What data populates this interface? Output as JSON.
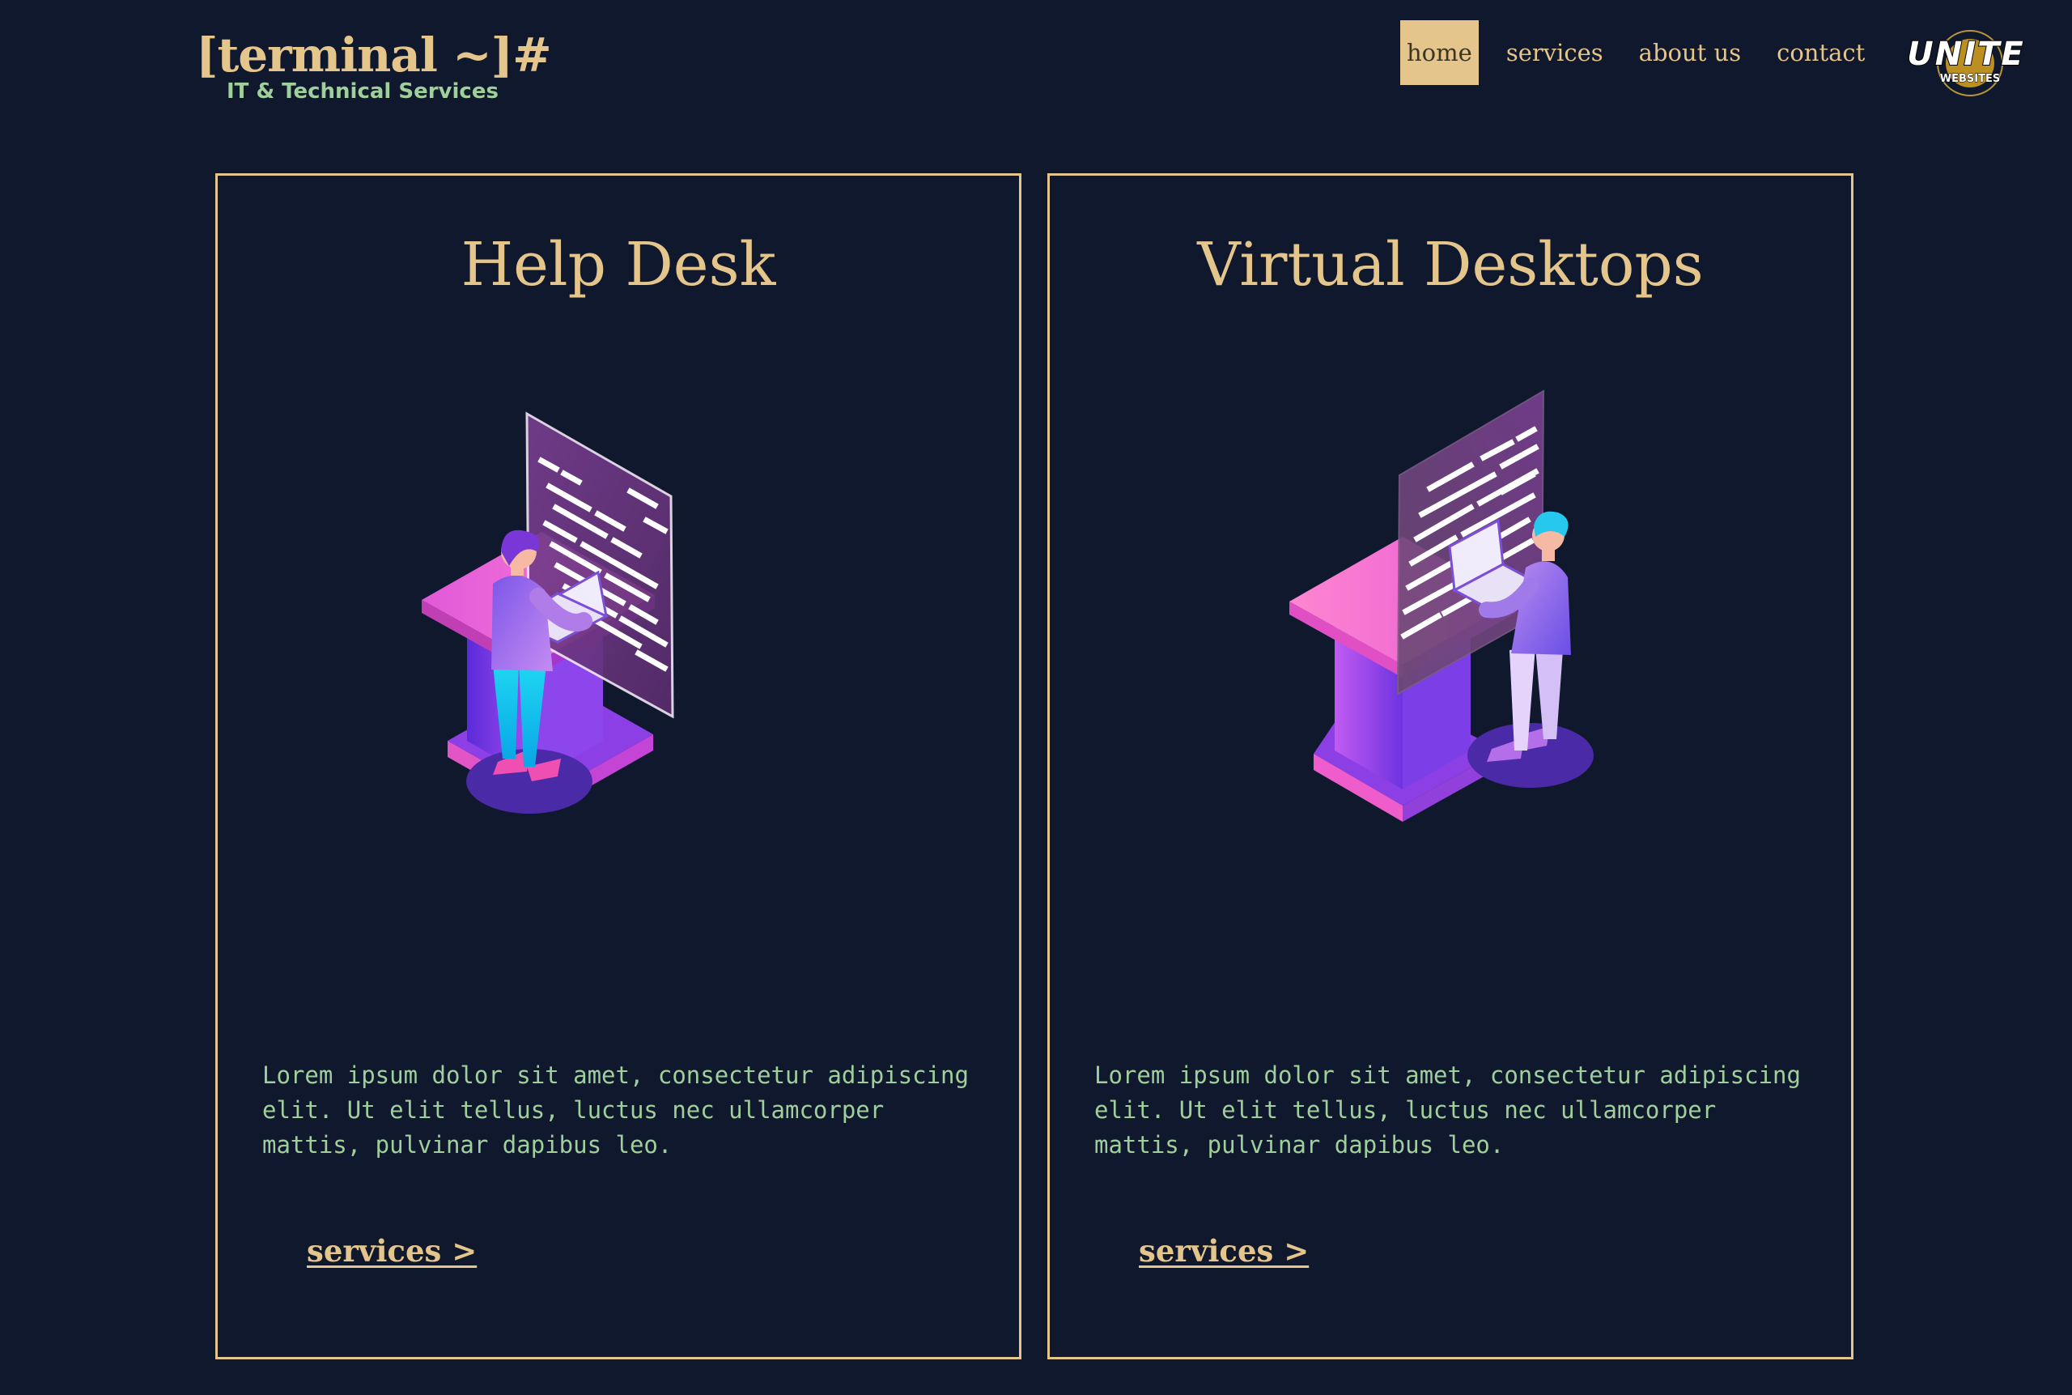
{
  "brand": {
    "title": "[terminal ~]#",
    "subtitle": "IT & Technical Services"
  },
  "nav": {
    "items": [
      {
        "label": "home",
        "active": true
      },
      {
        "label": "services",
        "active": false
      },
      {
        "label": "about us",
        "active": false
      },
      {
        "label": "contact",
        "active": false
      }
    ]
  },
  "logo": {
    "wordmark": "UNITE",
    "tagline": "WEBSITES"
  },
  "cards": [
    {
      "title": "Help Desk",
      "illustration": "person-at-laptop-with-code-screen-illustration",
      "text": "Lorem ipsum dolor sit amet, consectetur adipiscing elit. Ut elit tellus, luctus nec ullamcorper mattis, pulvinar dapibus leo.",
      "link_label": "services >"
    },
    {
      "title": "Virtual Desktops",
      "illustration": "person-at-laptop-with-code-screen-illustration",
      "text": "Lorem ipsum dolor sit amet, consectetur adipiscing elit. Ut elit tellus, luctus nec ullamcorper mattis, pulvinar dapibus leo.",
      "link_label": "services >"
    }
  ],
  "colors": {
    "background": "#10182d",
    "accent_gold": "#e4c58c",
    "text_green": "#9fcf9b"
  }
}
